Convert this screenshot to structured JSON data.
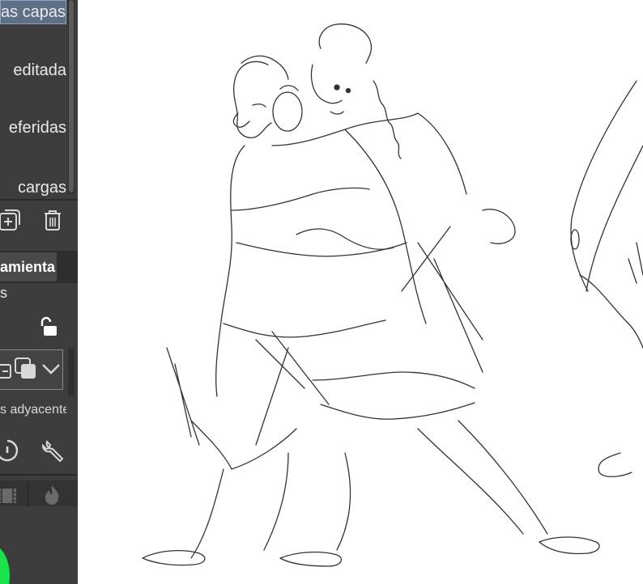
{
  "sidebar": {
    "menu_items": [
      {
        "label": "as capas"
      },
      {
        "label": "editada"
      },
      {
        "label": "eferidas"
      },
      {
        "label": "cargas"
      }
    ],
    "tool_tab_label": "amienta",
    "small_letter": "s",
    "adjacent_label": "s adyacente",
    "icons": [
      "new-layer-icon",
      "trash-icon",
      "unlock-icon",
      "layer-ops-icon",
      "copy-layer-icon",
      "chevron-down-icon",
      "reset-icon",
      "wrench-icon",
      "film-icon",
      "flame-icon"
    ]
  },
  "colors": {
    "sidebar_bg": "#3d3d3d",
    "selected_bg": "#5f6f86",
    "accent_green": "#19e24a",
    "canvas_bg": "#ffffff",
    "sketch_stroke": "#333333"
  }
}
